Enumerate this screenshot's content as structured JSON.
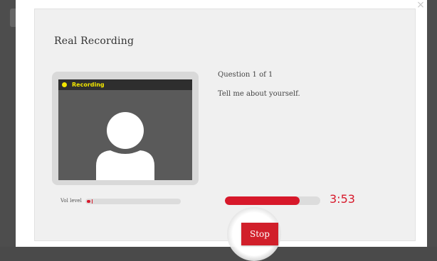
{
  "modal": {
    "title": "Real Recording",
    "close_label": "×"
  },
  "preview": {
    "status_label": "Recording",
    "status_dot_color": "#f2e600",
    "status_text_color": "#f2e600",
    "icon": "user-silhouette-icon"
  },
  "question": {
    "counter": "Question 1 of 1",
    "prompt": "Tell me about yourself."
  },
  "volume": {
    "label": "Vol level",
    "level": 0.04
  },
  "recording": {
    "progress": 0.78,
    "time_remaining": "3:53"
  },
  "controls": {
    "stop_label": "Stop"
  },
  "colors": {
    "accent": "#d7182a",
    "button": "#d11f2a"
  }
}
